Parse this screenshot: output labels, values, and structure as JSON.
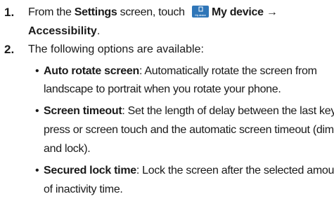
{
  "step1": {
    "number": "1.",
    "prefix": "From the ",
    "settings": "Settings",
    "middle": " screen, touch ",
    "icon_name": "my-device-icon",
    "icon_label": "My device",
    "my_device": "My device",
    "arrow": " →",
    "accessibility": "Accessibility",
    "period": "."
  },
  "step2": {
    "number": "2.",
    "text": "The following options are available:"
  },
  "bullets": [
    {
      "term": "Auto rotate screen",
      "line1": ": Automatically rotate the screen from",
      "line2": "landscape to portrait when you rotate your phone."
    },
    {
      "term": "Screen timeout",
      "line1": ": Set the length of delay between the last key",
      "line2": "press or screen touch and the automatic screen timeout (dim",
      "line3": "and lock)."
    },
    {
      "term": "Secured lock time",
      "line1": ": Lock the screen after the selected amount",
      "line2": "of inactivity time."
    }
  ]
}
